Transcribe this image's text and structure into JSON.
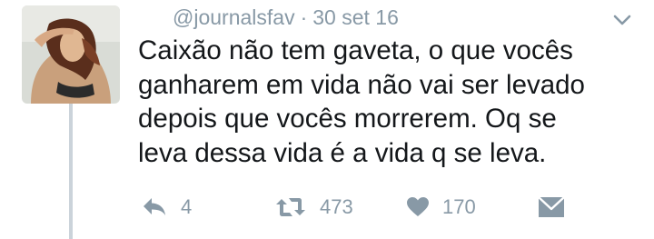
{
  "tweet": {
    "handle": "@journalsfav",
    "separator": "·",
    "date": "30 set 16",
    "text_lines": [
      "Caixão não tem gaveta, o que vocês",
      "ganharem em vida não vai ser levado",
      "depois que vocês morrerem. Oq se",
      "leva dessa vida é a vida q se leva."
    ]
  },
  "actions": {
    "reply_count": "4",
    "retweet_count": "473",
    "like_count": "170"
  },
  "icons": {
    "chevron": "chevron-down-icon",
    "reply": "reply-icon",
    "retweet": "retweet-icon",
    "like": "heart-icon",
    "dm": "envelope-icon"
  },
  "colors": {
    "text": "#14171a",
    "muted": "#8899a6",
    "thread_line": "#cbd3da"
  }
}
